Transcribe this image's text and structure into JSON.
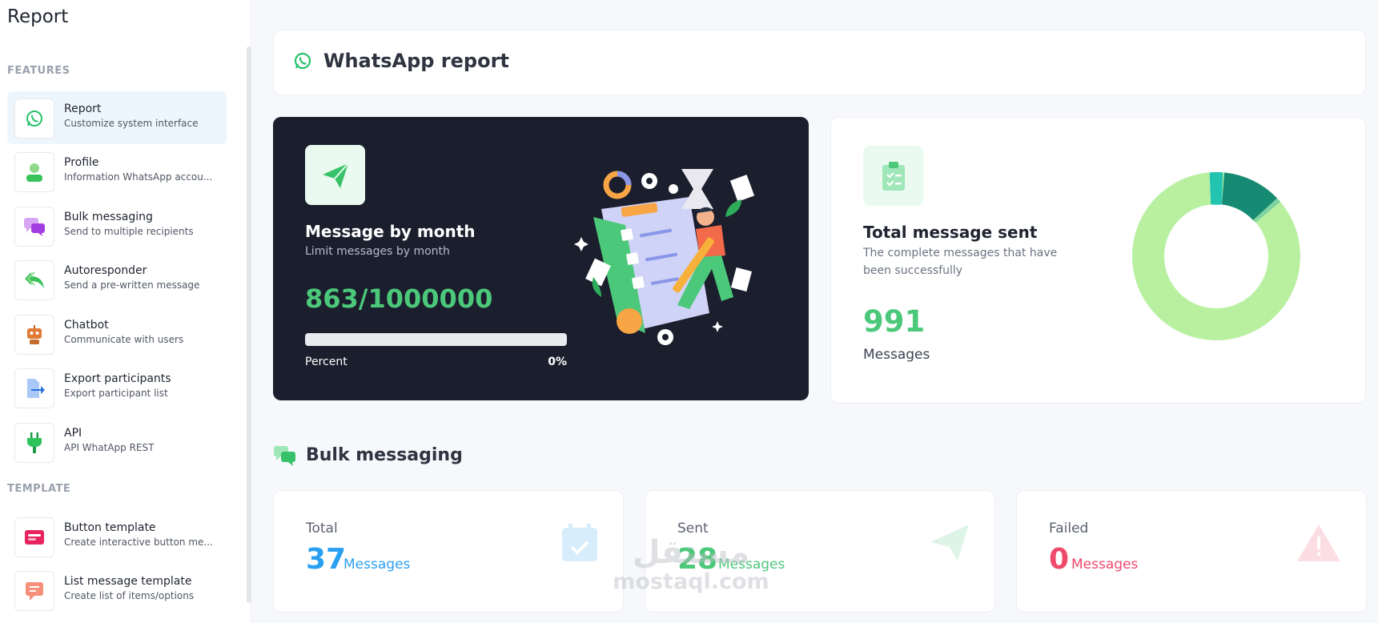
{
  "sidebar": {
    "title": "Report",
    "sections": {
      "features": "FEATURES",
      "template": "TEMPLATE"
    },
    "items": [
      {
        "title": "Report",
        "subtitle": "Customize system interface",
        "icon": "whatsapp-icon"
      },
      {
        "title": "Profile",
        "subtitle": "Information WhatsApp accou...",
        "icon": "profile-icon"
      },
      {
        "title": "Bulk messaging",
        "subtitle": "Send to multiple recipients",
        "icon": "chat-bubbles-icon"
      },
      {
        "title": "Autoresponder",
        "subtitle": "Send a pre-written message",
        "icon": "reply-icon"
      },
      {
        "title": "Chatbot",
        "subtitle": "Communicate with users",
        "icon": "robot-icon"
      },
      {
        "title": "Export participants",
        "subtitle": "Export participant list",
        "icon": "export-icon"
      },
      {
        "title": "API",
        "subtitle": "API WhatApp REST",
        "icon": "plug-icon"
      }
    ],
    "template_items": [
      {
        "title": "Button template",
        "subtitle": "Create interactive button me...",
        "icon": "button-template-icon"
      },
      {
        "title": "List message template",
        "subtitle": "Create list of items/options",
        "icon": "list-message-icon"
      }
    ]
  },
  "header": {
    "title": "WhatsApp report",
    "icon": "whatsapp-icon"
  },
  "monthly": {
    "title": "Message by month",
    "subtitle": "Limit messages by month",
    "value": "863/1000000",
    "percent_label": "Percent",
    "percent_value": "0%",
    "progress": 0
  },
  "total": {
    "title": "Total message sent",
    "subtitle": "The complete messages that have been successfully",
    "value": "991",
    "unit": "Messages"
  },
  "bulk": {
    "title": "Bulk messaging",
    "stats": [
      {
        "label": "Total",
        "value": "37",
        "unit": "Messages",
        "color": "#2aa0f0",
        "icon": "calendar-check-icon"
      },
      {
        "label": "Sent",
        "value": "28",
        "unit": "Messages",
        "color": "#4cc87a",
        "icon": "paper-plane-icon"
      },
      {
        "label": "Failed",
        "value": "0",
        "unit": "Messages",
        "color": "#ef4a6b",
        "icon": "warning-icon"
      }
    ]
  },
  "watermark": {
    "arabic": "مستقل",
    "latin": "mostaql.com"
  },
  "colors": {
    "accent": "#4cc87a",
    "dark_card": "#1b1e2d",
    "donut_main": "#b8f0a0",
    "donut_dark": "#178a74",
    "donut_teal": "#22c4b0"
  }
}
